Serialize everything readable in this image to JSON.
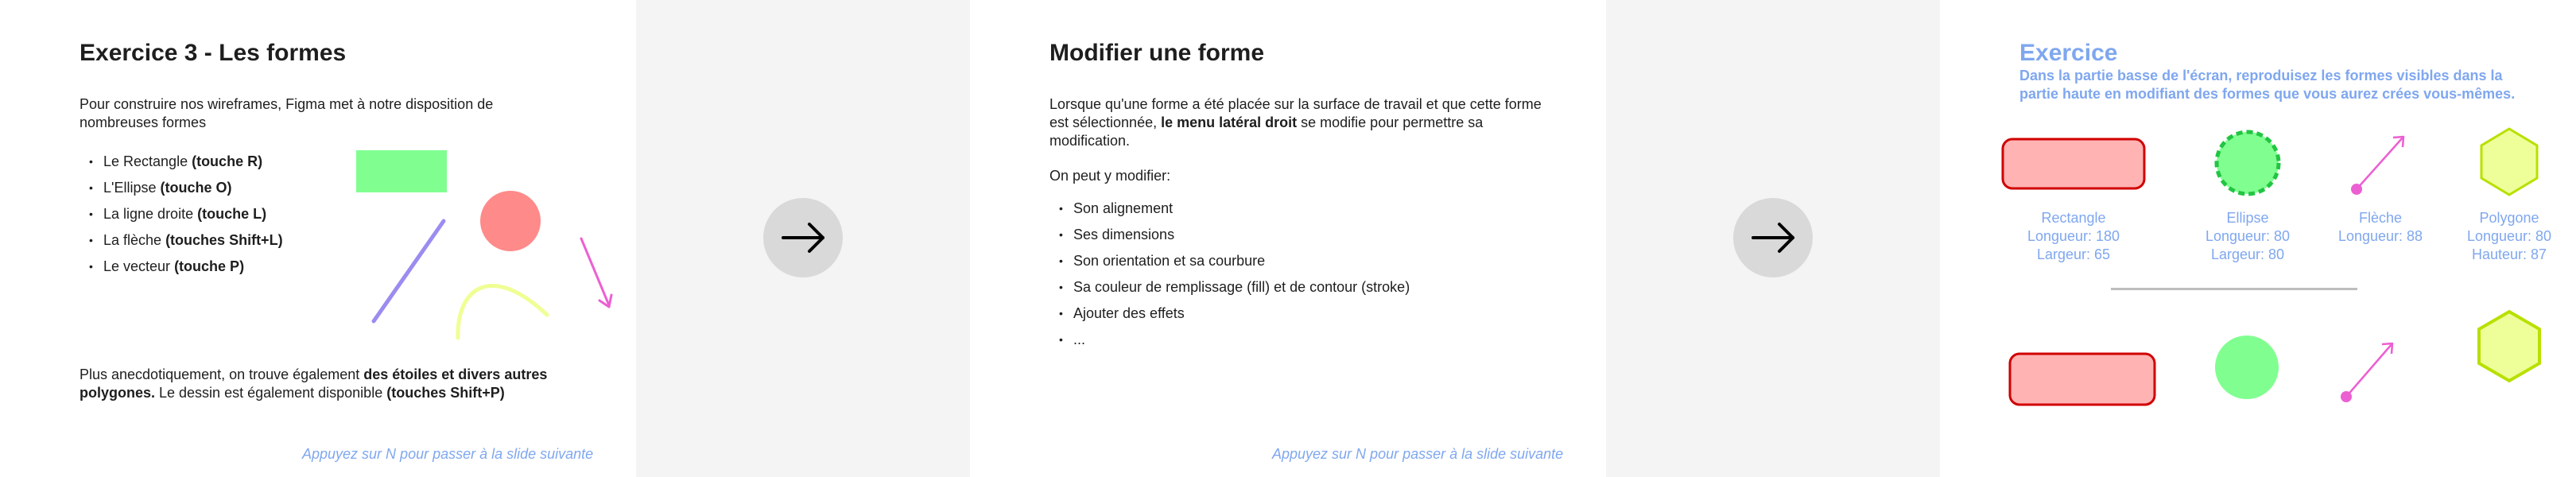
{
  "slide1": {
    "title": "Exercice 3 - Les formes",
    "intro": "Pour construire nos wireframes, Figma met à notre disposition de nombreuses formes",
    "items": [
      {
        "text": "Le Rectangle ",
        "key": "(touche R)"
      },
      {
        "text": "L'Ellipse ",
        "key": "(touche O)"
      },
      {
        "text": "La ligne droite ",
        "key": "(touche L)"
      },
      {
        "text": "La flèche ",
        "key": "(touches Shift+L)"
      },
      {
        "text": "Le vecteur ",
        "key": "(touche P)"
      }
    ],
    "outro": {
      "part1": "Plus anecdotiquement, on trouve également ",
      "bold1": "des étoiles et divers autres polygones.",
      "part2": " Le dessin est également disponible ",
      "bold2": "(touches Shift+P)"
    },
    "footer": "Appuyez sur N pour passer à la slide suivante"
  },
  "connector_icon": "arrow-right-icon",
  "slide2": {
    "title": "Modifier une forme",
    "intro": {
      "part1": "Lorsque qu'une forme a été placée sur la surface de travail et que cette forme est sélectionnée, ",
      "bold": "le menu latéral droit",
      "part2": " se modifie pour permettre sa modification."
    },
    "lead": "On peut y modifier:",
    "items": [
      "Son alignement",
      "Ses dimensions",
      "Son orientation et sa courbure",
      "Sa couleur de remplissage (fill) et de contour (stroke)",
      "Ajouter des effets",
      "..."
    ],
    "footer": "Appuyez sur N pour passer à la slide suivante"
  },
  "slide3": {
    "title": "Exercice",
    "description": "Dans la partie basse de l'écran, reproduisez les formes visibles dans la partie haute en modifiant des formes que vous aurez crées vous-mêmes.",
    "labels": {
      "rect": {
        "name": "Rectangle",
        "l1": "Longueur: 180",
        "l2": "Largeur: 65"
      },
      "ellipse": {
        "name": "Ellipse",
        "l1": "Longueur: 80",
        "l2": "Largeur: 80"
      },
      "arrow": {
        "name": "Flèche",
        "l1": "Longueur: 88"
      },
      "polygon": {
        "name": "Polygone",
        "l1": "Longueur: 80",
        "l2": "Hauteur: 87"
      }
    }
  },
  "colors": {
    "accent": "#7fa7ef",
    "green": "#80ff90",
    "red": "#ff8a8a",
    "purple": "#9a8cf0",
    "yellow": "#f0ff94",
    "pink": "#ec5fd2",
    "pinkFill": "#ffb3b3",
    "rectStroke": "#d00000",
    "ellipseStroke": "#22c542",
    "hexFill": "#eeff9a",
    "hexStroke": "#b8e000"
  }
}
